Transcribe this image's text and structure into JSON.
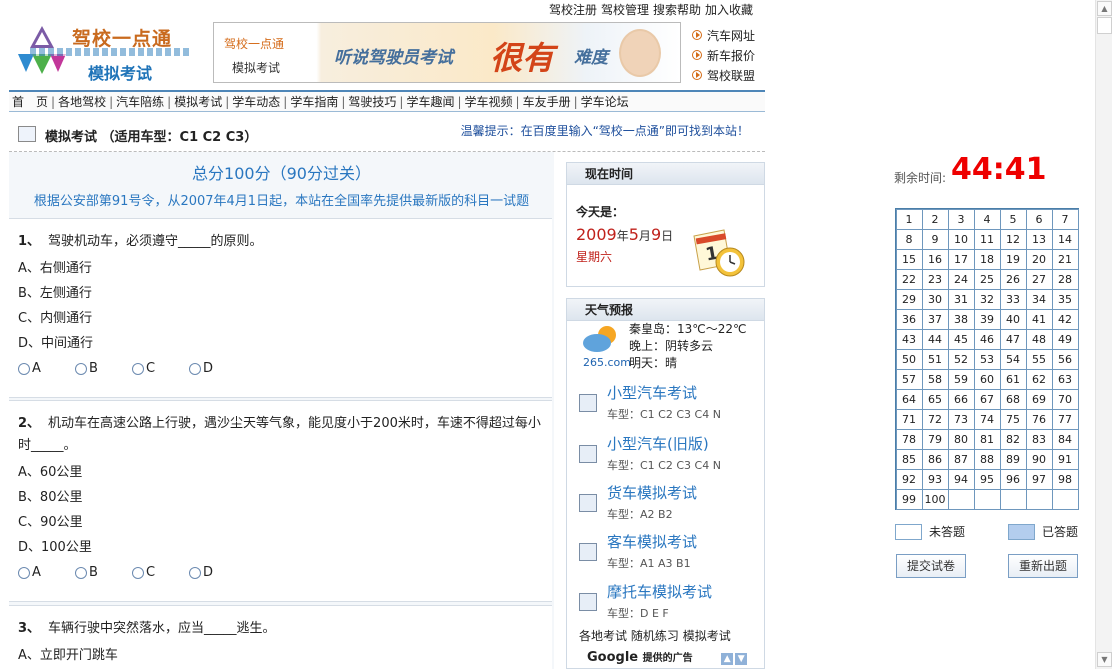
{
  "top_links": [
    "驾校注册",
    "驾校管理",
    "搜索帮助",
    "加入收藏"
  ],
  "logo": {
    "line1": "驾校一点通",
    "line2": "模拟考试"
  },
  "banner": {
    "small1": "驾校一点通",
    "small2": "模拟考试",
    "slogan_a": "听说驾驶员考试",
    "slogan_b": "很有",
    "slogan_c": "难度"
  },
  "side_links": [
    "汽车网址",
    "新车报价",
    "驾校联盟"
  ],
  "nav": [
    "首　页",
    "各地驾校",
    "汽车陪练",
    "模拟考试",
    "学车动态",
    "学车指南",
    "驾驶技巧",
    "学车趣闻",
    "学车视频",
    "车友手册",
    "学车论坛"
  ],
  "title": "模拟考试 （适用车型：C1 C2 C3）",
  "tip": "温馨提示：在百度里输入“驾校一点通”即可找到本站！",
  "score_line": "总分100分（90分过关）",
  "notice": "根据公安部第91号令，从2007年4月1日起，本站在全国率先提供最新版的科目一试题",
  "questions": [
    {
      "num": "1、",
      "text": "驾驶机动车，必须遵守_____的原则。",
      "options": [
        "A、右侧通行",
        "B、左侧通行",
        "C、内侧通行",
        "D、中间通行"
      ],
      "choices": [
        "A",
        "B",
        "C",
        "D"
      ]
    },
    {
      "num": "2、",
      "text": "机动车在高速公路上行驶，遇沙尘天等气象，能见度小于200米时，车速不得超过每小时_____。",
      "options": [
        "A、60公里",
        "B、80公里",
        "C、90公里",
        "D、100公里"
      ],
      "choices": [
        "A",
        "B",
        "C",
        "D"
      ]
    },
    {
      "num": "3、",
      "text": "车辆行驶中突然落水，应当_____逃生。",
      "options": [
        "A、立即开门跳车"
      ],
      "choices": []
    }
  ],
  "time_box": {
    "head": "现在时间",
    "today_label": "今天是：",
    "year": "2009",
    "y_unit": "年",
    "month": "5",
    "m_unit": "月",
    "day": "9",
    "d_unit": "日",
    "weekday": "星期六"
  },
  "weather": {
    "head": "天气预报",
    "site": "265.com",
    "line1": "秦皇岛：13℃～22℃",
    "line2": "晚上：阴转多云",
    "line3": "明天：晴"
  },
  "exams": [
    {
      "name": "小型汽车考试",
      "cars": "车型：C1 C2 C3 C4 N"
    },
    {
      "name": "小型汽车(旧版)",
      "cars": "车型：C1 C2 C3 C4 N"
    },
    {
      "name": "货车模拟考试",
      "cars": "车型：A2 B2"
    },
    {
      "name": "客车模拟考试",
      "cars": "车型：A1 A3 B1"
    },
    {
      "name": "摩托车模拟考试",
      "cars": "车型：D E F"
    }
  ],
  "weather_links": [
    "各地考试",
    "随机练习",
    "模拟考试"
  ],
  "google": {
    "brand": "Google",
    "ads": "提供的广告"
  },
  "remaining_label": "剩余时间:",
  "timer": "44:41",
  "question_numbers": [
    "1",
    "2",
    "3",
    "4",
    "5",
    "6",
    "7",
    "8",
    "9",
    "10",
    "11",
    "12",
    "13",
    "14",
    "15",
    "16",
    "17",
    "18",
    "19",
    "20",
    "21",
    "22",
    "23",
    "24",
    "25",
    "26",
    "27",
    "28",
    "29",
    "30",
    "31",
    "32",
    "33",
    "34",
    "35",
    "36",
    "37",
    "38",
    "39",
    "40",
    "41",
    "42",
    "43",
    "44",
    "45",
    "46",
    "47",
    "48",
    "49",
    "50",
    "51",
    "52",
    "53",
    "54",
    "55",
    "56",
    "57",
    "58",
    "59",
    "60",
    "61",
    "62",
    "63",
    "64",
    "65",
    "66",
    "67",
    "68",
    "69",
    "70",
    "71",
    "72",
    "73",
    "74",
    "75",
    "76",
    "77",
    "78",
    "79",
    "80",
    "81",
    "82",
    "83",
    "84",
    "85",
    "86",
    "87",
    "88",
    "89",
    "90",
    "91",
    "92",
    "93",
    "94",
    "95",
    "96",
    "97",
    "98",
    "99",
    "100"
  ],
  "legend": {
    "unanswered": "未答题",
    "answered": "已答题"
  },
  "buttons": {
    "submit": "提交试卷",
    "restart": "重新出题"
  },
  "colors": {
    "answered": "#b3cdee",
    "unanswered": "#ffffff",
    "timer": "#e00000",
    "accent": "#2a77c0"
  }
}
